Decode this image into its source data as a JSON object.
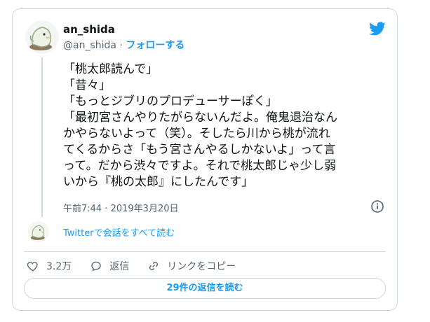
{
  "author": {
    "name": "an_shida",
    "handle": "@an_shida",
    "separator": "·",
    "follow_label": "フォローする"
  },
  "tweet": {
    "lines": [
      "「桃太郎読んで」",
      "「昔々」",
      "「もっとジブリのプロデューサーぽく」",
      "「最初宮さんやりたがらないんだよ。俺鬼退治なん",
      "かやらないよって（笑）。そしたら川から桃が流れ",
      "てくるからさ「もう宮さんやるしかないよ」って言",
      "って。だから渋々ですよ。それで桃太郎じゃ少し弱",
      "いから『桃の太郎』にしたんです」"
    ],
    "timestamp": "午前7:44 · 2019年3月20日"
  },
  "thread_link_label": "Twitterで会話をすべて読む",
  "actions": {
    "like_count": "3.2万",
    "reply_label": "返信",
    "copy_link_label": "リンクをコピー"
  },
  "replies_button_label": "29件の返信を読む",
  "colors": {
    "accent": "#1d9bf0",
    "text": "#0f1419",
    "muted": "#536471",
    "border": "#cfd9de"
  },
  "icons": [
    "twitter-bird-icon",
    "info-icon",
    "heart-icon",
    "reply-icon",
    "link-icon"
  ]
}
